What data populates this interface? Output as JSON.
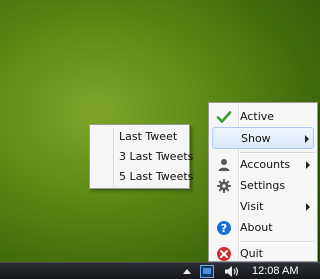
{
  "context_menu": {
    "items": [
      {
        "label": "Active",
        "icon": "checkmark-icon",
        "checked": true
      },
      {
        "label": "Show",
        "icon": "",
        "has_submenu": true,
        "highlighted": true
      },
      {
        "label": "Accounts",
        "icon": "user-icon",
        "has_submenu": true
      },
      {
        "label": "Settings",
        "icon": "gear-icon"
      },
      {
        "label": "Visit",
        "icon": "",
        "has_submenu": true
      },
      {
        "label": "About",
        "icon": "question-icon"
      },
      {
        "label": "Quit",
        "icon": "quit-icon"
      }
    ]
  },
  "show_submenu": {
    "items": [
      {
        "label": "Last Tweet"
      },
      {
        "label": "3 Last Tweets"
      },
      {
        "label": "5 Last Tweets"
      }
    ]
  },
  "taskbar": {
    "clock": "12:08 AM",
    "icons": [
      "show-hidden-icons-arrow",
      "app-tray-icon",
      "speaker-icon"
    ]
  },
  "colors": {
    "check": "#2f9e2f",
    "about": "#1e6fd0",
    "quit": "#d42c2c",
    "highlight_border": "#aecbef"
  }
}
